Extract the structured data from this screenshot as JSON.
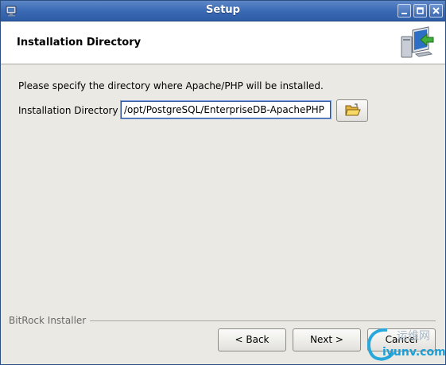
{
  "window": {
    "title": "Setup"
  },
  "header": {
    "title": "Installation Directory",
    "icon": "computer-install-arrow-icon"
  },
  "body": {
    "intro_text": "Please specify the directory where Apache/PHP will be installed.",
    "directory_label": "Installation Directory",
    "directory_value": "/opt/PostgreSQL/EnterpriseDB-ApachePHP",
    "browse_icon": "open-folder-icon"
  },
  "footer": {
    "installer_label": "BitRock Installer",
    "back_label": "< Back",
    "next_label": "Next >",
    "cancel_label": "Cancel"
  },
  "watermark": {
    "cn_text": "运维网",
    "en_text": "iyunv.com"
  },
  "colors": {
    "titlebar": "#3b6ab5",
    "window_bg": "#eae9e4",
    "input_border": "#2c4f99",
    "watermark_blue": "#1d9fd6"
  }
}
